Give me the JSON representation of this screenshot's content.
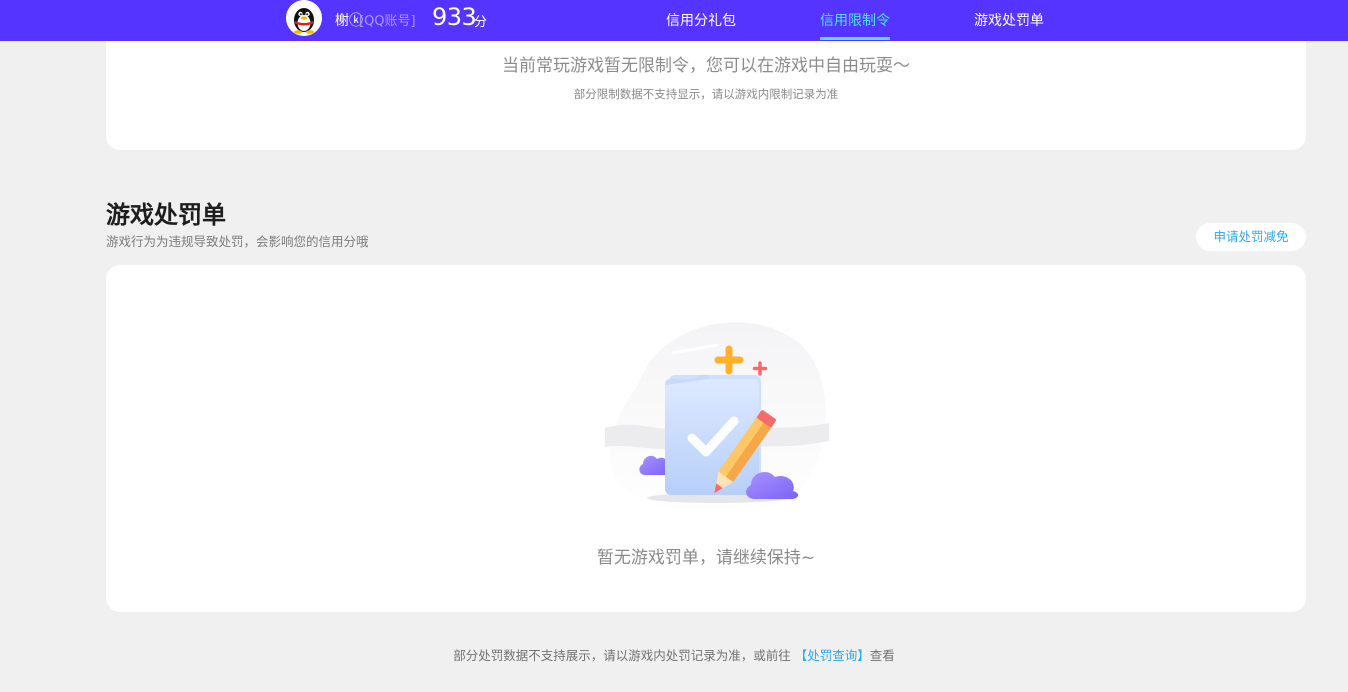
{
  "header": {
    "nickname": "榭ⓚ",
    "account_type": "[QQ账号]",
    "score": "933",
    "score_unit": "分",
    "nav": [
      {
        "label": "信用分礼包",
        "active": false
      },
      {
        "label": "信用限制令",
        "active": true
      },
      {
        "label": "游戏处罚单",
        "active": false
      }
    ]
  },
  "limit_card": {
    "message": "当前常玩游戏暂无限制令，您可以在游戏中自由玩耍～",
    "note": "部分限制数据不支持显示，请以游戏内限制记录为准"
  },
  "penalty_section": {
    "title": "游戏处罚单",
    "description": "游戏行为为违规导致处罚，会影响您的信用分哦",
    "apply_button": "申请处罚减免",
    "empty_message": "暂无游戏罚单，请继续保持~"
  },
  "footer": {
    "text_before": "部分处罚数据不支持展示，请以游戏内处罚记录为准，或前往",
    "link": "【处罚查询】",
    "text_after": "查看"
  },
  "colors": {
    "header_bg": "#5534ff",
    "active_nav": "#4ce4ff",
    "link": "#2da9ec",
    "page_bg": "#f0f0f0"
  },
  "icons": [
    "qq-penguin-avatar",
    "empty-penalty-illustration"
  ]
}
